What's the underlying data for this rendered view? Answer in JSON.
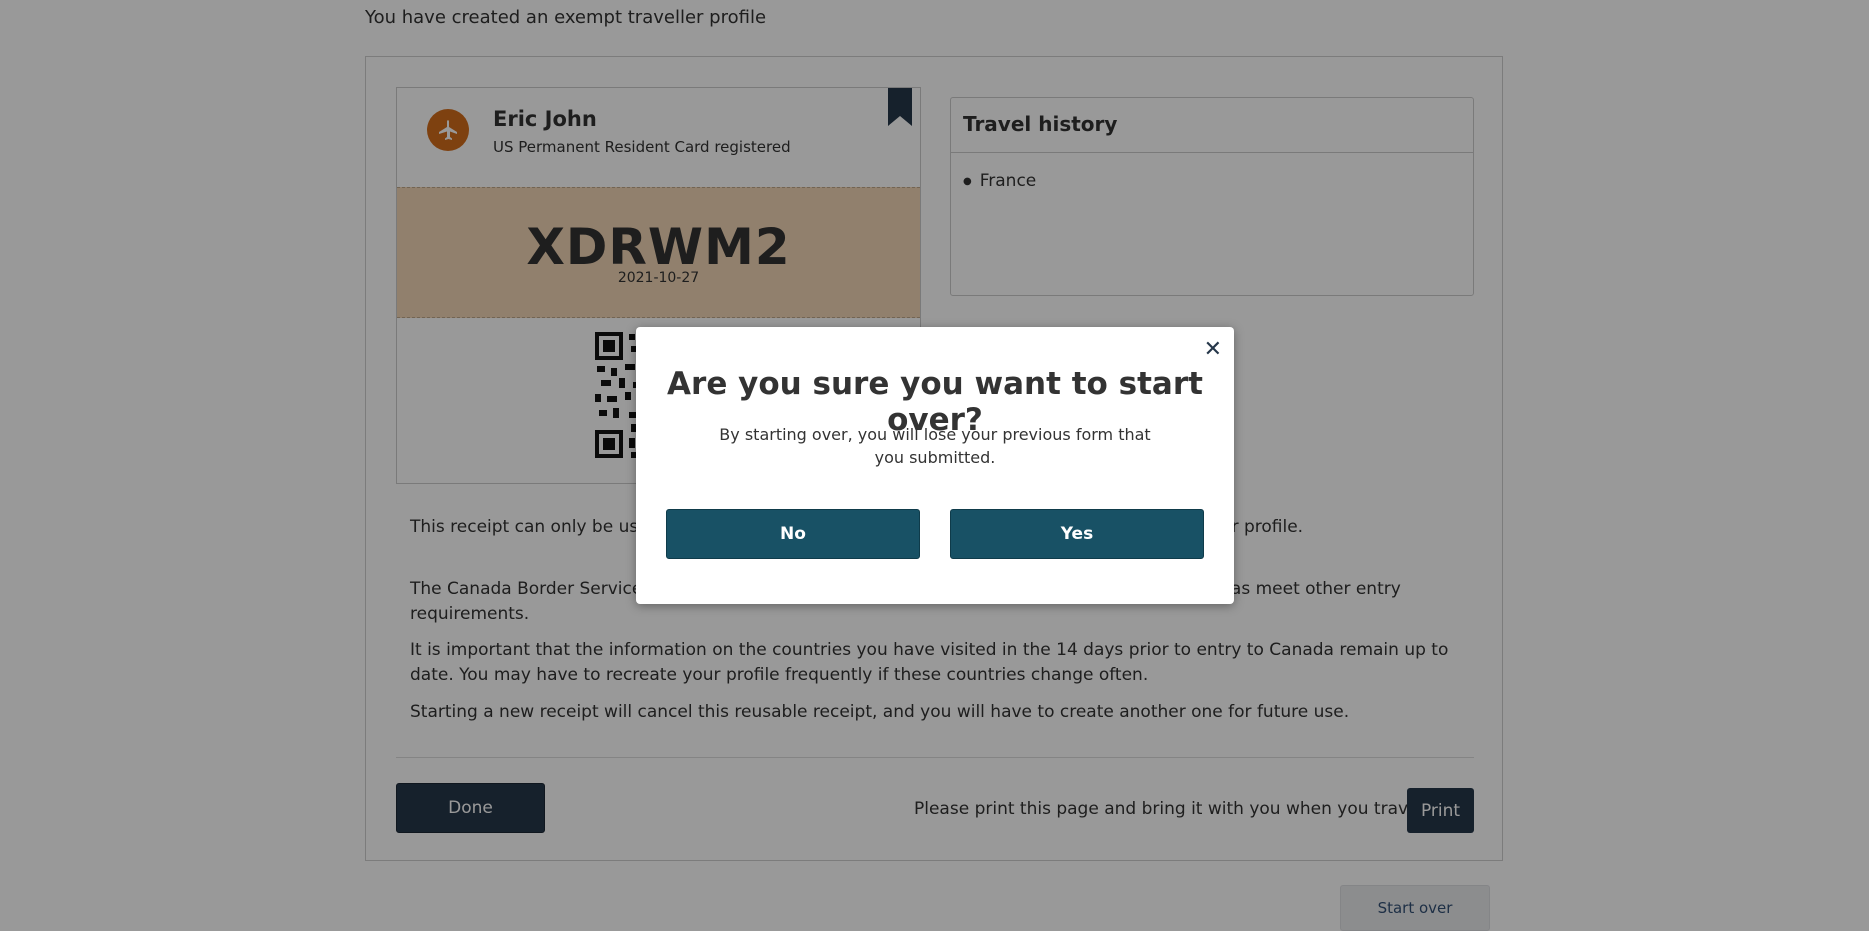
{
  "intro_text": "You have created an exempt traveller profile",
  "card": {
    "name": "Eric John",
    "subtitle": "US Permanent Resident Card registered",
    "code": "XDRWM2",
    "date": "2021-10-27",
    "icon": "airplane-icon"
  },
  "travel_history": {
    "title": "Travel history",
    "items": [
      "France"
    ]
  },
  "paragraphs": [
    "This receipt can only be used if you have travelled to the countries you listed when creating your profile.",
    "The Canada Border Services Agency may ask you to start over and create a new receipt as well as meet other entry requirements.",
    "It is important that the information on the countries you have visited in the 14 days prior to entry to Canada remain up to date. You may have to recreate your profile frequently if these countries change often.",
    "Starting a new receipt will cancel this reusable receipt, and you will have to create another one for future use."
  ],
  "footer": {
    "done_label": "Done",
    "print_message": "Please print this page and bring it with you when you travel.",
    "print_label": "Print",
    "start_over_label": "Start over"
  },
  "modal": {
    "title": "Are you sure you want to start over?",
    "body": "By starting over, you will lose your previous form that you submitted.",
    "no_label": "No",
    "yes_label": "Yes",
    "close_symbol": "✕"
  },
  "colors": {
    "primary": "#26374a",
    "modal_button": "#185165",
    "accent": "#d36d1c",
    "code_band": "#f2d6b6"
  }
}
